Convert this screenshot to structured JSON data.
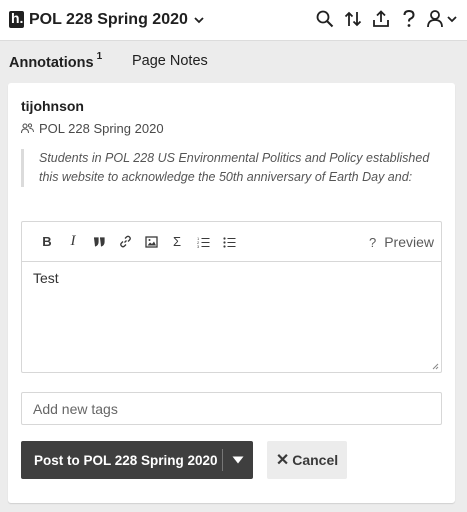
{
  "header": {
    "group_name": "POL 228 Spring 2020"
  },
  "tabs": {
    "annotations_label": "Annotations",
    "annotations_count": "1",
    "page_notes_label": "Page Notes"
  },
  "annotation": {
    "username": "tijohnson",
    "group": "POL 228 Spring 2020",
    "quote": "Students in POL 228 US Environmental Politics and Policy established this website to acknowledge the 50th anniversary of Earth Day and:",
    "toolbar": {
      "bold": "B",
      "italic": "I",
      "quote": "”",
      "math": "Σ",
      "help": "?",
      "preview_label": "Preview"
    },
    "body_text": "Test",
    "tags_placeholder": "Add new tags",
    "post_label": "Post to POL 228 Spring 2020",
    "cancel_label": "Cancel",
    "cancel_glyph": "✕"
  },
  "icons": [
    "hypothesis-logo-icon",
    "chevron-down-icon",
    "search-icon",
    "sort-icon",
    "share-icon",
    "help-icon",
    "user-icon",
    "link-icon",
    "image-icon",
    "numbered-list-icon",
    "bullet-list-icon",
    "groups-icon",
    "resize-handle-icon",
    "caret-down-icon"
  ]
}
